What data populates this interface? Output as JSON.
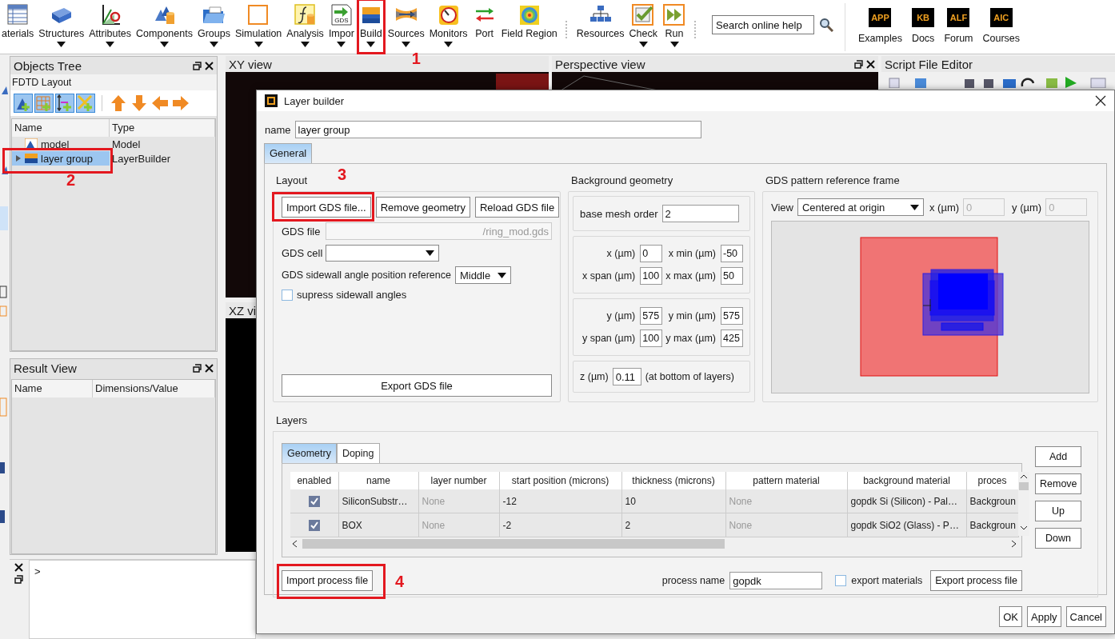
{
  "toolbar": {
    "groups": [
      [
        {
          "label": "aterials",
          "dropdown": false
        },
        {
          "label": "Structures",
          "dropdown": true
        },
        {
          "label": "Attributes",
          "dropdown": true
        },
        {
          "label": "Components",
          "dropdown": true
        },
        {
          "label": "Groups",
          "dropdown": true
        },
        {
          "label": "Simulation",
          "dropdown": true
        },
        {
          "label": "Analysis",
          "dropdown": true
        },
        {
          "label": "Impor",
          "dropdown": true,
          "icon_text": "GDS"
        },
        {
          "label": "Build",
          "dropdown": true,
          "callout": "1"
        },
        {
          "label": "Sources",
          "dropdown": true
        },
        {
          "label": "Monitors",
          "dropdown": true
        },
        {
          "label": "Port",
          "dropdown": false
        },
        {
          "label": "Field Region",
          "dropdown": false
        }
      ],
      [
        {
          "label": "Resources",
          "dropdown": false
        },
        {
          "label": "Check",
          "dropdown": true
        },
        {
          "label": "Run",
          "dropdown": true
        }
      ]
    ],
    "search": {
      "placeholder": "Search online help"
    },
    "links": [
      {
        "badge": "APP",
        "label": "Examples"
      },
      {
        "badge": "KB",
        "label": "Docs"
      },
      {
        "badge": "ALF",
        "label": "Forum"
      },
      {
        "badge": "AIC",
        "label": "Courses"
      }
    ]
  },
  "objects_tree": {
    "title": "Objects Tree",
    "subtitle": "FDTD Layout",
    "columns": [
      "Name",
      "Type"
    ],
    "rows": [
      {
        "kind": "model",
        "name": "model",
        "type": "Model",
        "selected": false
      },
      {
        "kind": "group",
        "name": "layer group",
        "type": "LayerBuilder",
        "selected": true,
        "expanded": false,
        "callout": "2"
      }
    ]
  },
  "result_view": {
    "title": "Result View",
    "columns": [
      "Name",
      "Dimensions/Value"
    ]
  },
  "views": [
    {
      "title": "XY view"
    },
    {
      "title": "XZ vi"
    },
    {
      "title": "Perspective view"
    },
    {
      "title": "Script File Editor"
    }
  ],
  "console": {
    "prompt": ">"
  },
  "dialog": {
    "title": "Layer builder",
    "name_label": "name",
    "name_value": "layer group",
    "tabs": [
      {
        "label": "General",
        "selected": true
      }
    ],
    "layout": {
      "title": "Layout",
      "buttons": [
        {
          "label": "Import GDS file...",
          "callout": "3"
        },
        {
          "label": "Remove geometry"
        },
        {
          "label": "Reload GDS file"
        }
      ],
      "gds_file_label": "GDS file",
      "gds_file_value": "/ring_mod.gds",
      "gds_cell_label": "GDS cell",
      "sidewall_label": "GDS sidewall angle position reference",
      "sidewall_value": "Middle",
      "suppress": {
        "label": "supress sidewall angles",
        "checked": false
      },
      "export_button": "Export GDS file"
    },
    "background": {
      "title": "Background geometry",
      "mesh_label": "base mesh order",
      "mesh_value": "2",
      "groups": [
        [
          {
            "label": "x (µm)",
            "value": "0"
          },
          {
            "label": "x min (µm)",
            "value": "-50"
          },
          {
            "label": "x span (µm)",
            "value": "100"
          },
          {
            "label": "x max (µm)",
            "value": "50"
          }
        ],
        [
          {
            "label": "y (µm)",
            "value": "575"
          },
          {
            "label": "y min (µm)",
            "value": "575"
          },
          {
            "label": "y span (µm)",
            "value": "100"
          },
          {
            "label": "y max (µm)",
            "value": "425"
          }
        ]
      ],
      "z_label": "z (µm)",
      "z_value": "0.11",
      "z_note": "(at bottom of layers)"
    },
    "frame": {
      "title": "GDS pattern reference frame",
      "view_label": "View",
      "view_value": "Centered at origin",
      "x_label": "x (µm)",
      "x_value": "0",
      "y_label": "y (µm)",
      "y_value": "0"
    },
    "layers": {
      "title": "Layers",
      "tabs": [
        {
          "label": "Geometry",
          "selected": true
        },
        {
          "label": "Doping",
          "selected": false
        }
      ],
      "columns": [
        "enabled",
        "name",
        "layer number",
        "start position (microns)",
        "thickness (microns)",
        "pattern material",
        "background material",
        "proces"
      ],
      "rows": [
        {
          "cells": [
            {
              "kind": "checkbox",
              "checked": true
            },
            "SiliconSubstr…",
            {
              "kind": "text",
              "text": "None",
              "disabled": true
            },
            "-12",
            "10",
            {
              "kind": "text",
              "text": "None",
              "disabled": true
            },
            "gopdk Si (Silicon) - Pal…",
            "Backgroun"
          ]
        },
        {
          "cells": [
            {
              "kind": "checkbox",
              "checked": true
            },
            "BOX",
            {
              "kind": "text",
              "text": "None",
              "disabled": true
            },
            "-2",
            "2",
            {
              "kind": "text",
              "text": "None",
              "disabled": true
            },
            "gopdk SiO2 (Glass) - P…",
            "Backgroun"
          ]
        }
      ],
      "side_buttons": [
        "Add",
        "Remove",
        "Up",
        "Down"
      ],
      "import_button": {
        "label": "Import process file",
        "callout": "4"
      },
      "process_label": "process name",
      "process_value": "gopdk",
      "export_materials": {
        "label": "export materials",
        "checked": false
      },
      "export_button": "Export process file"
    },
    "buttons": [
      "OK",
      "Apply",
      "Cancel"
    ]
  }
}
